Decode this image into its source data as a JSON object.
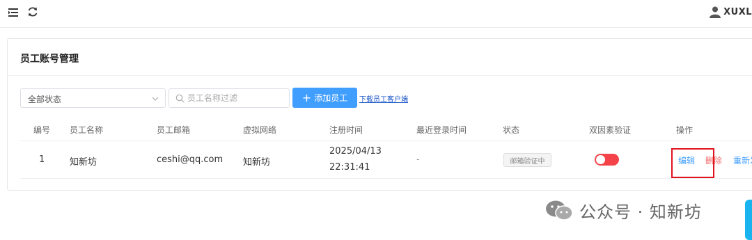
{
  "topbar": {
    "user_name": "XUXL"
  },
  "page": {
    "title": "员工账号管理"
  },
  "filters": {
    "status_select": "全部状态",
    "search_placeholder": "员工名称过滤",
    "add_button": "添加员工",
    "download_link": "下载员工客户端"
  },
  "table": {
    "headers": [
      "编号",
      "员工名称",
      "员工邮箱",
      "虚拟网络",
      "注册时间",
      "最近登录时间",
      "状态",
      "双因素验证",
      "操作"
    ],
    "rows": [
      {
        "id": "1",
        "name": "知新坊",
        "email": "ceshi@qq.com",
        "network": "知新坊",
        "reg_date": "2025/04/13",
        "reg_time": "22:31:41",
        "last_login": "-",
        "status": "邮箱验证中",
        "two_factor": false,
        "actions": {
          "edit": "编辑",
          "delete": "删除",
          "more": "重新发"
        }
      }
    ]
  },
  "watermark": {
    "text": "公众号 · 知新坊"
  },
  "colors": {
    "primary": "#409eff",
    "danger": "#f56c6c",
    "toggle_off": "#f5434a",
    "highlight": "#e0141e"
  }
}
